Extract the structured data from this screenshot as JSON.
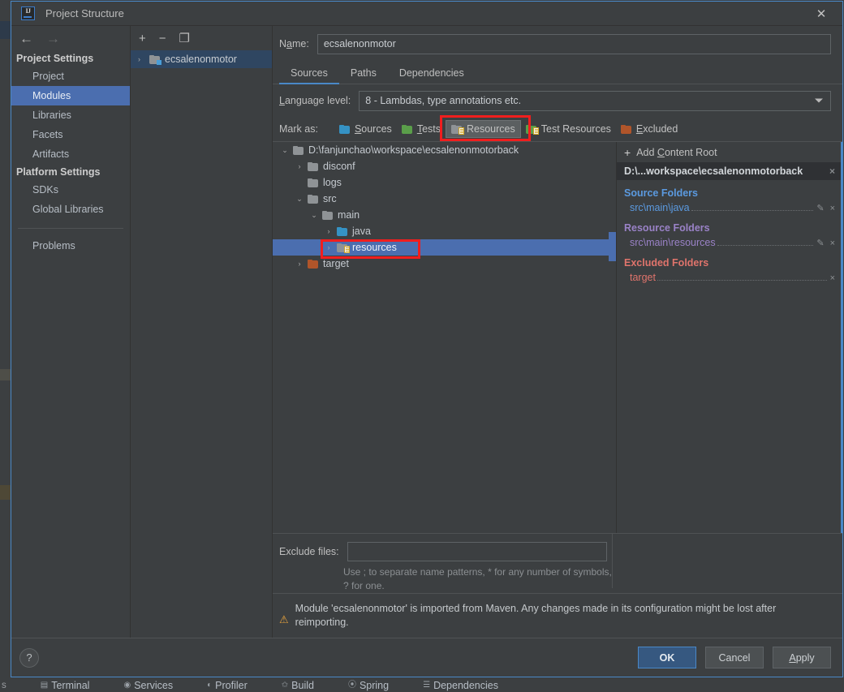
{
  "dialog": {
    "title": "Project Structure",
    "logo_text": "IJ",
    "close_icon": "close-icon"
  },
  "sidebar": {
    "back_icon": "←",
    "forward_icon": "→",
    "project_settings_title": "Project Settings",
    "platform_settings_title": "Platform Settings",
    "project_items": [
      {
        "label": "Project",
        "selected": false
      },
      {
        "label": "Modules",
        "selected": true
      },
      {
        "label": "Libraries",
        "selected": false
      },
      {
        "label": "Facets",
        "selected": false
      },
      {
        "label": "Artifacts",
        "selected": false
      }
    ],
    "platform_items": [
      {
        "label": "SDKs",
        "selected": false
      },
      {
        "label": "Global Libraries",
        "selected": false
      }
    ],
    "problems_label": "Problems"
  },
  "module_panel": {
    "toolbar": {
      "add_icon": "+",
      "remove_icon": "−",
      "copy_icon": "❐"
    },
    "modules": [
      {
        "name": "ecsalenonmotor",
        "selected": true,
        "expander": "›"
      }
    ]
  },
  "main": {
    "name_label": "Name:",
    "name_value": "ecsalenonmotor",
    "tabs": [
      {
        "label": "Sources",
        "active": true
      },
      {
        "label": "Paths",
        "active": false
      },
      {
        "label": "Dependencies",
        "active": false
      }
    ],
    "language_level_label": "Language level:",
    "language_level_value": "8 - Lambdas, type annotations etc.",
    "mark_as_label": "Mark as:",
    "mark_as_buttons": [
      {
        "label": "Sources",
        "color": "#3592c4",
        "pressed": false
      },
      {
        "label": "Tests",
        "color": "#5a9e4a",
        "pressed": false
      },
      {
        "label": "Resources",
        "color": "#8f9396",
        "pressed": true
      },
      {
        "label": "Test Resources",
        "color": "#5a9e4a",
        "pressed": false
      },
      {
        "label": "Excluded",
        "color": "#b0552a",
        "pressed": false
      }
    ]
  },
  "tree": [
    {
      "label": "D:\\fanjunchao\\workspace\\ecsalenonmotorback",
      "indent": 0,
      "expander": "⌄",
      "icon": "folder-gray",
      "selected": false
    },
    {
      "label": "disconf",
      "indent": 1,
      "expander": "›",
      "icon": "folder-gray",
      "selected": false
    },
    {
      "label": "logs",
      "indent": 1,
      "expander": "",
      "icon": "folder-gray",
      "selected": false
    },
    {
      "label": "src",
      "indent": 1,
      "expander": "⌄",
      "icon": "folder-gray",
      "selected": false
    },
    {
      "label": "main",
      "indent": 2,
      "expander": "⌄",
      "icon": "folder-gray",
      "selected": false
    },
    {
      "label": "java",
      "indent": 3,
      "expander": "›",
      "icon": "folder-blue",
      "selected": false
    },
    {
      "label": "resources",
      "indent": 3,
      "expander": "›",
      "icon": "folder-resource",
      "selected": true
    },
    {
      "label": "target",
      "indent": 1,
      "expander": "›",
      "icon": "folder-orange",
      "selected": false
    }
  ],
  "roots": {
    "add_content_root_label": "Add Content Root",
    "add_icon": "+",
    "content_root_path": "D:\\...workspace\\ecsalenonmotorback",
    "remove_icon": "×",
    "groups": [
      {
        "title": "Source Folders",
        "kind": "source",
        "entries": [
          {
            "path": "src\\main\\java",
            "has_edit": true,
            "has_remove": true
          }
        ]
      },
      {
        "title": "Resource Folders",
        "kind": "resource",
        "entries": [
          {
            "path": "src\\main\\resources",
            "has_edit": true,
            "has_remove": true
          }
        ]
      },
      {
        "title": "Excluded Folders",
        "kind": "excluded",
        "entries": [
          {
            "path": "target",
            "has_edit": false,
            "has_remove": true
          }
        ]
      }
    ],
    "edit_icon": "✎",
    "close_icon": "×"
  },
  "exclude": {
    "label": "Exclude files:",
    "value": "",
    "placeholder": "",
    "hint": "Use ; to separate name patterns, * for any number of symbols, ? for one."
  },
  "warning": {
    "icon": "⚠",
    "text": "Module 'ecsalenonmotor' is imported from Maven. Any changes made in its configuration might be lost after reimporting."
  },
  "footer": {
    "help_label": "?",
    "ok_label": "OK",
    "cancel_label": "Cancel",
    "apply_label": "Apply"
  },
  "ide_statusbar": {
    "leading": "s",
    "items": [
      {
        "icon": "terminal-icon",
        "label": "Terminal"
      },
      {
        "icon": "services-icon",
        "label": "Services"
      },
      {
        "icon": "profiler-icon",
        "label": "Profiler"
      },
      {
        "icon": "build-icon",
        "label": "Build"
      },
      {
        "icon": "spring-icon",
        "label": "Spring"
      },
      {
        "icon": "dependencies-icon",
        "label": "Dependencies"
      }
    ]
  },
  "colors": {
    "accent_blue": "#4a88c7",
    "selection_blue": "#4b6eaf",
    "panel_bg": "#3c3f41",
    "highlight_red": "#f01e1e",
    "source_blue": "#5b9ae0",
    "resource_purple": "#9a82c7",
    "excluded_red": "#e0746c",
    "warning_amber": "#e8a33d"
  }
}
